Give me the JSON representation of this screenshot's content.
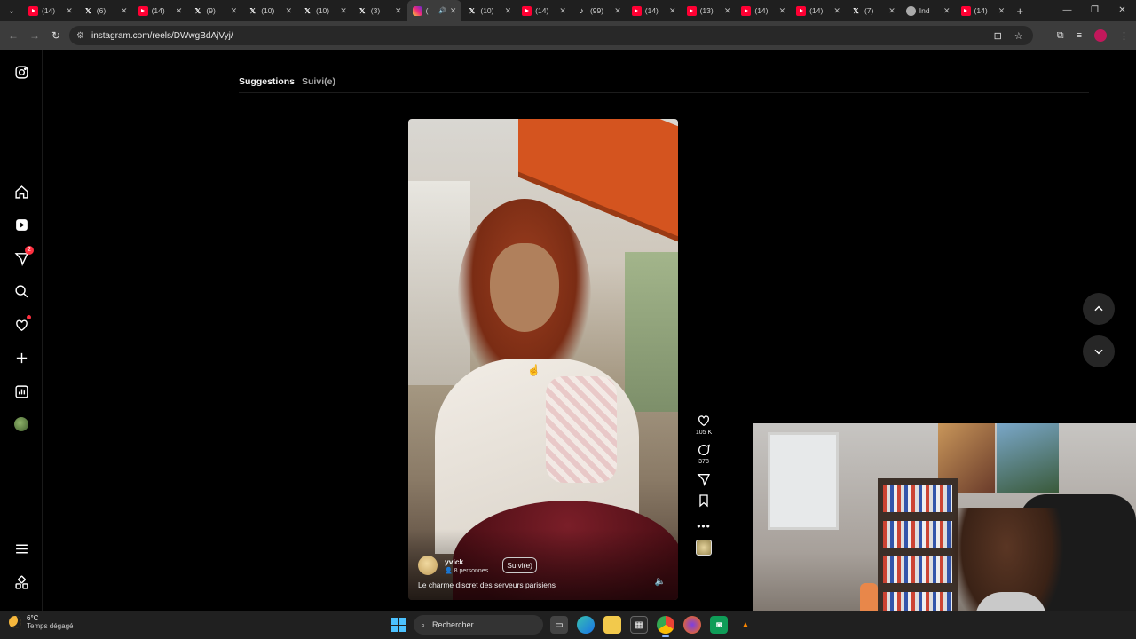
{
  "browser": {
    "tabs": [
      {
        "title": "(14)",
        "favicon": "youtube-icon"
      },
      {
        "title": "(6)",
        "favicon": "x-icon"
      },
      {
        "title": "(14)",
        "favicon": "youtube-icon"
      },
      {
        "title": "(9)",
        "favicon": "x-icon"
      },
      {
        "title": "(10)",
        "favicon": "x-icon"
      },
      {
        "title": "(10)",
        "favicon": "x-icon"
      },
      {
        "title": "(3)",
        "favicon": "x-icon"
      },
      {
        "title": "(",
        "favicon": "instagram-icon",
        "active": true
      },
      {
        "title": "(10)",
        "favicon": "x-icon"
      },
      {
        "title": "(14)",
        "favicon": "youtube-icon"
      },
      {
        "title": "(99)",
        "favicon": "tiktok-icon"
      },
      {
        "title": "(14)",
        "favicon": "youtube-icon"
      },
      {
        "title": "(13)",
        "favicon": "youtube-icon"
      },
      {
        "title": "(14)",
        "favicon": "youtube-icon"
      },
      {
        "title": "(14)",
        "favicon": "youtube-icon"
      },
      {
        "title": "(7)",
        "favicon": "x-icon"
      },
      {
        "title": "Ind",
        "favicon": "globe-icon"
      },
      {
        "title": "(14)",
        "favicon": "youtube-icon"
      }
    ],
    "url": "instagram.com/reels/DWwgBdAjVyj/"
  },
  "instagram": {
    "feed_tabs": {
      "suggestions": "Suggestions",
      "following": "Suivi(e)"
    },
    "sidebar": {
      "notifications_badge": "2"
    },
    "reel": {
      "username": "yvick",
      "viewers": "8 personnes",
      "follow_label": "Suivi(e)",
      "caption": "Le charme discret des serveurs parisiens",
      "likes": "105 K",
      "comments": "378"
    }
  },
  "taskbar": {
    "temperature": "6°C",
    "weather": "Temps dégagé",
    "search_placeholder": "Rechercher"
  },
  "colors": {
    "accent": "#ff3040",
    "background": "#000000",
    "windows_accent": "#4cc2ff"
  }
}
